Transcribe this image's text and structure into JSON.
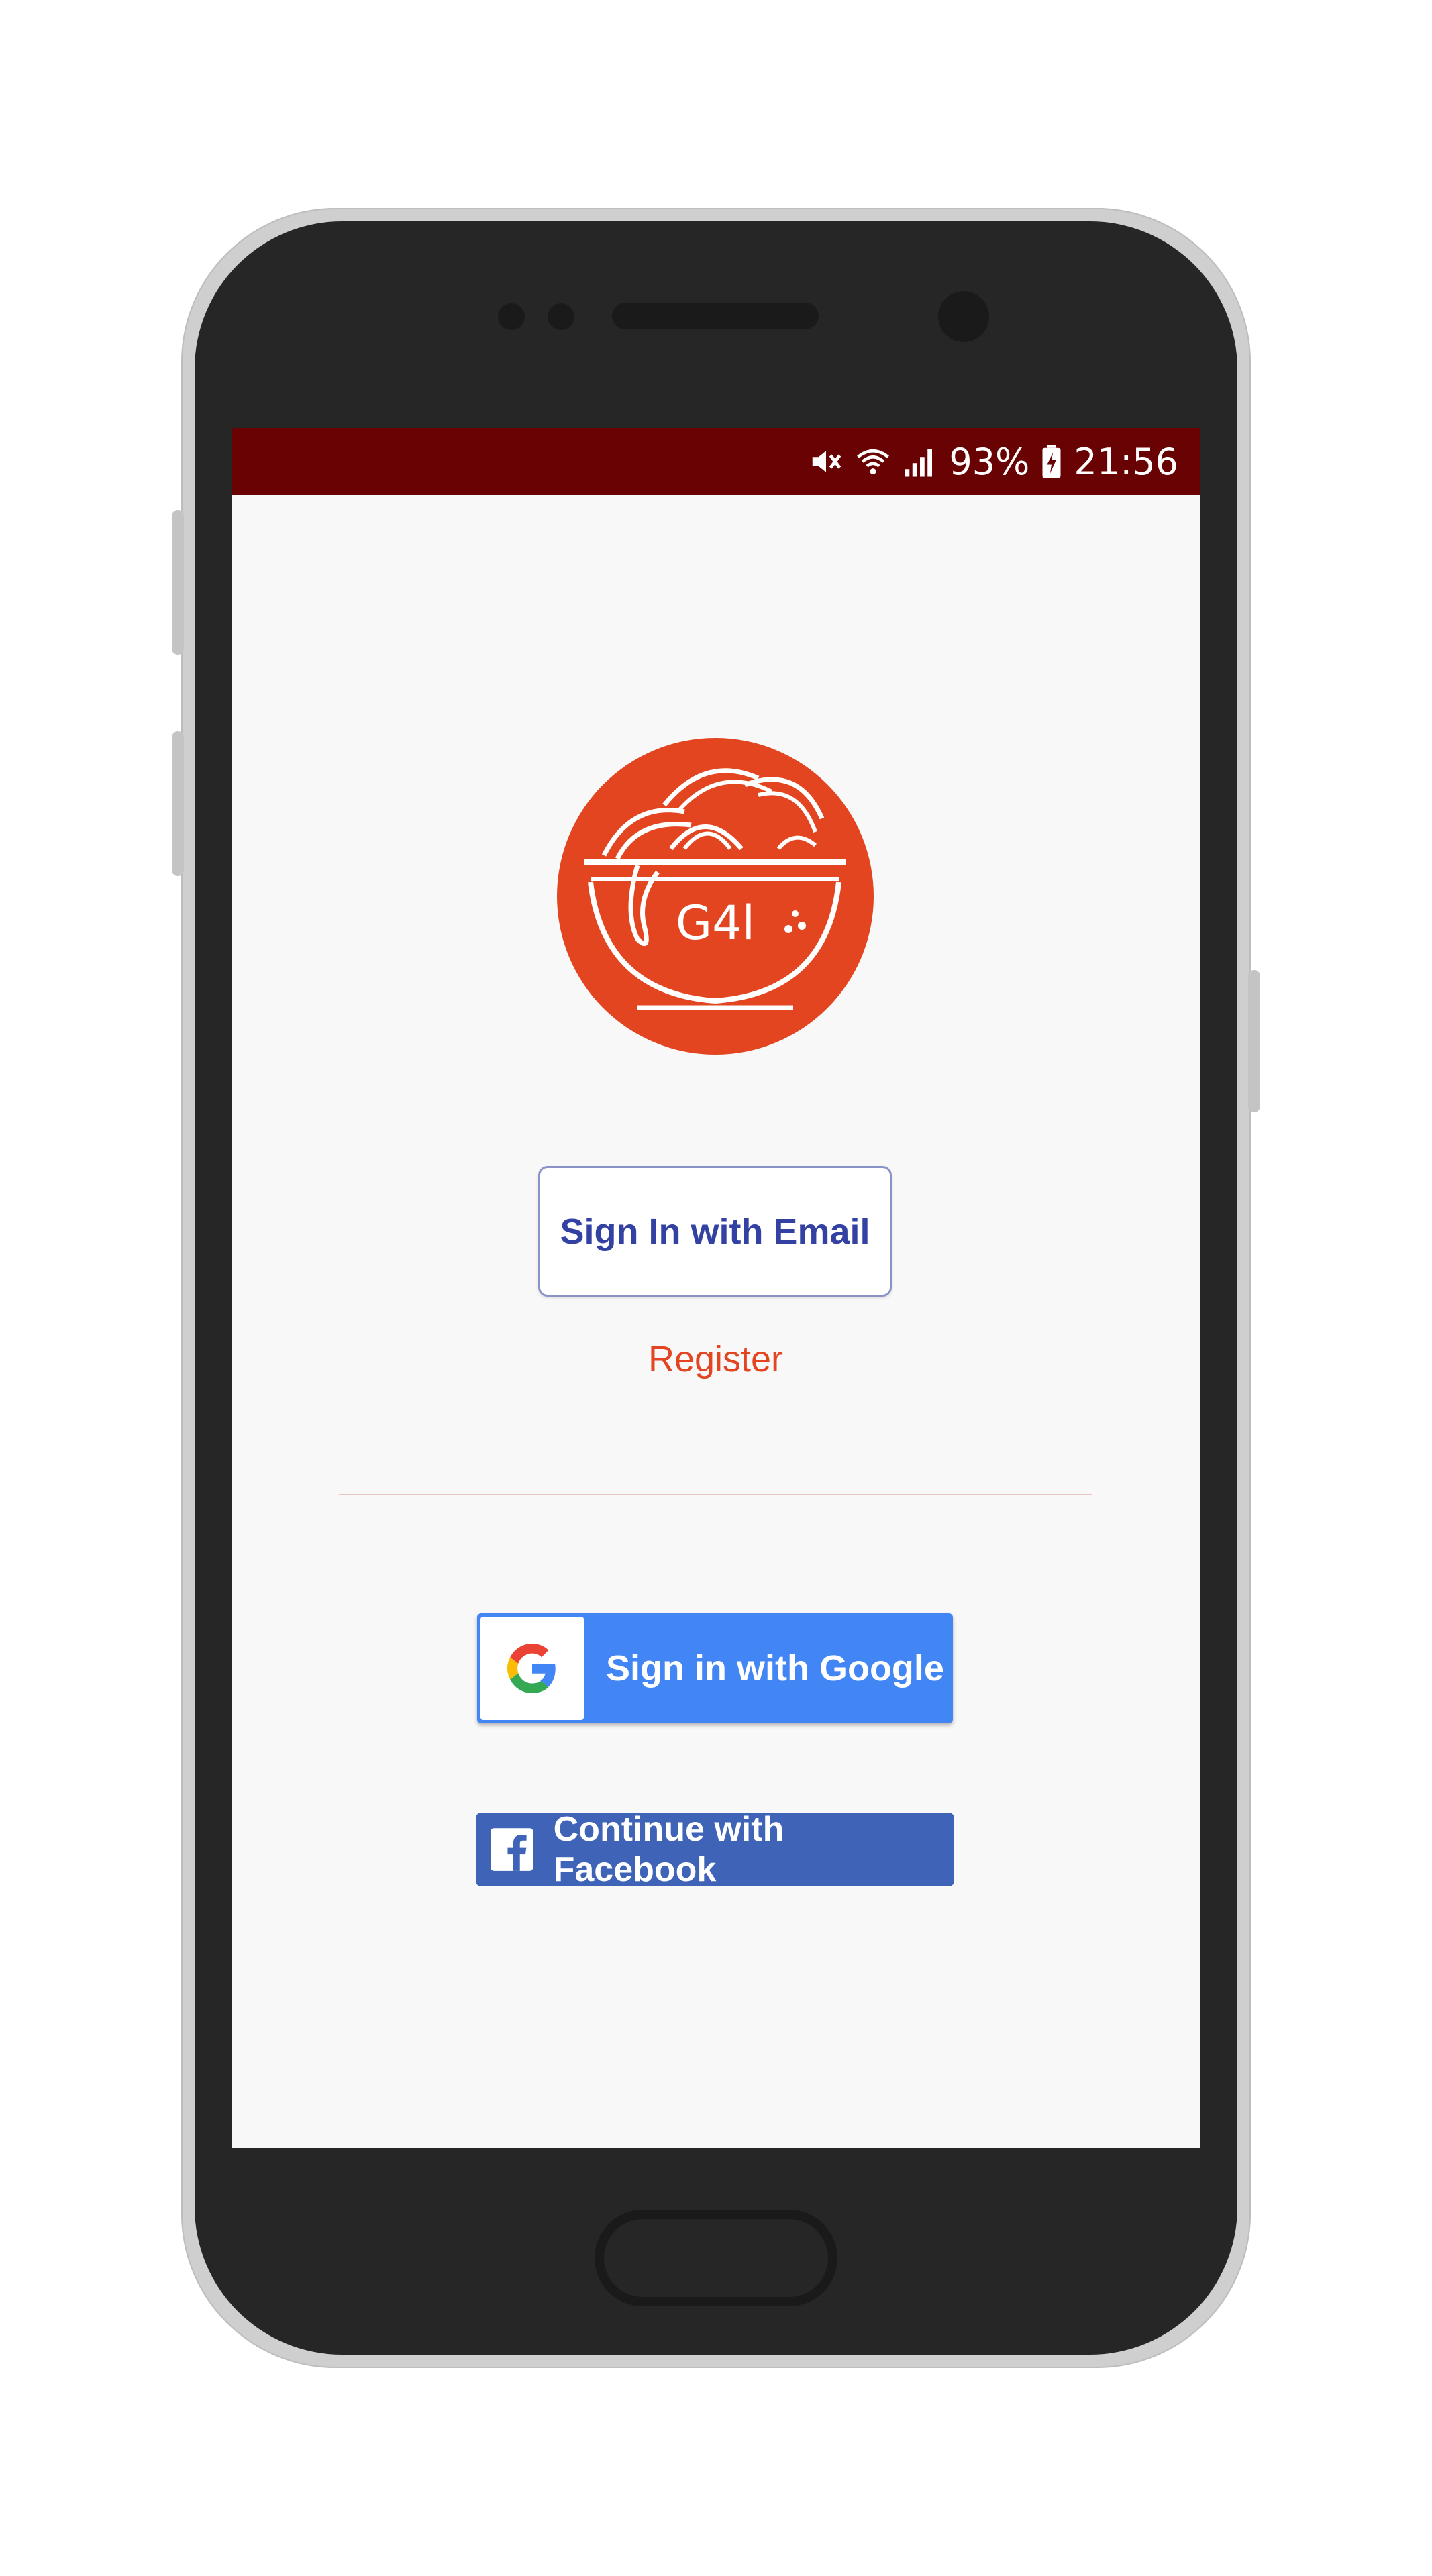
{
  "status_bar": {
    "battery": "93%",
    "time": "21:56",
    "icons": [
      "mute-icon",
      "wifi-icon",
      "signal-icon",
      "battery-charging-icon"
    ]
  },
  "logo": {
    "text": "G4l",
    "color": "#e2451f"
  },
  "auth": {
    "email_button": "Sign In with Email",
    "register_link": "Register",
    "google_button": "Sign in with Google",
    "facebook_button": "Continue with Facebook"
  },
  "colors": {
    "status_bar": "#690303",
    "accent": "#e2451f",
    "email_text": "#3341a3",
    "google_blue": "#4285f4",
    "facebook_blue": "#3f63b6"
  }
}
